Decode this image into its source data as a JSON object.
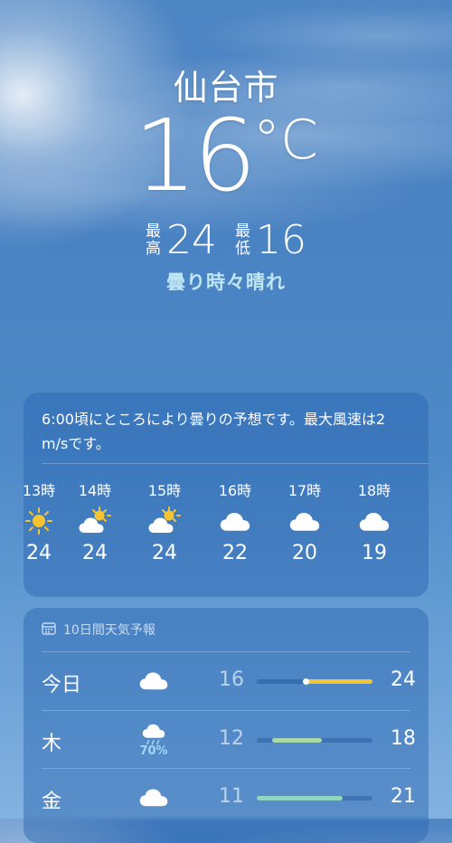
{
  "location": {
    "city": "仙台市"
  },
  "current": {
    "temp": "16",
    "unit": "°C",
    "condition": "曇り時々晴れ"
  },
  "high": {
    "label1": "最",
    "label2": "高",
    "value": "24"
  },
  "low": {
    "label1": "最",
    "label2": "低",
    "value": "16"
  },
  "hourly": {
    "summary": "6:00頃にところにより曇りの予想です。最大風速は2 m/sです。",
    "hours": [
      {
        "time": "13時",
        "icon": "sun-icon",
        "temp": "24"
      },
      {
        "time": "14時",
        "icon": "partly-sunny-icon",
        "temp": "24"
      },
      {
        "time": "15時",
        "icon": "partly-sunny-icon",
        "temp": "24"
      },
      {
        "time": "16時",
        "icon": "cloud-icon",
        "temp": "22"
      },
      {
        "time": "17時",
        "icon": "cloud-icon",
        "temp": "20"
      },
      {
        "time": "18時",
        "icon": "cloud-icon",
        "temp": "19"
      }
    ]
  },
  "daily": {
    "title": "10日間天気予報",
    "days": [
      {
        "day": "今日",
        "icon": "cloud-icon",
        "precip": "",
        "low": "16",
        "high": "24",
        "range_start": 0.42,
        "range_end": 1.0,
        "current_pos": 0.42,
        "fill_color": "#f2c53a"
      },
      {
        "day": "木",
        "icon": "cloud-rain-icon",
        "precip": "70%",
        "low": "12",
        "high": "18",
        "range_start": 0.13,
        "range_end": 0.56,
        "fill_color": "#a8d8a8"
      },
      {
        "day": "金",
        "icon": "cloud-icon",
        "precip": "",
        "low": "11",
        "high": "21",
        "range_start": 0.0,
        "range_end": 0.74,
        "fill_color": "#8ed6c0"
      }
    ]
  }
}
